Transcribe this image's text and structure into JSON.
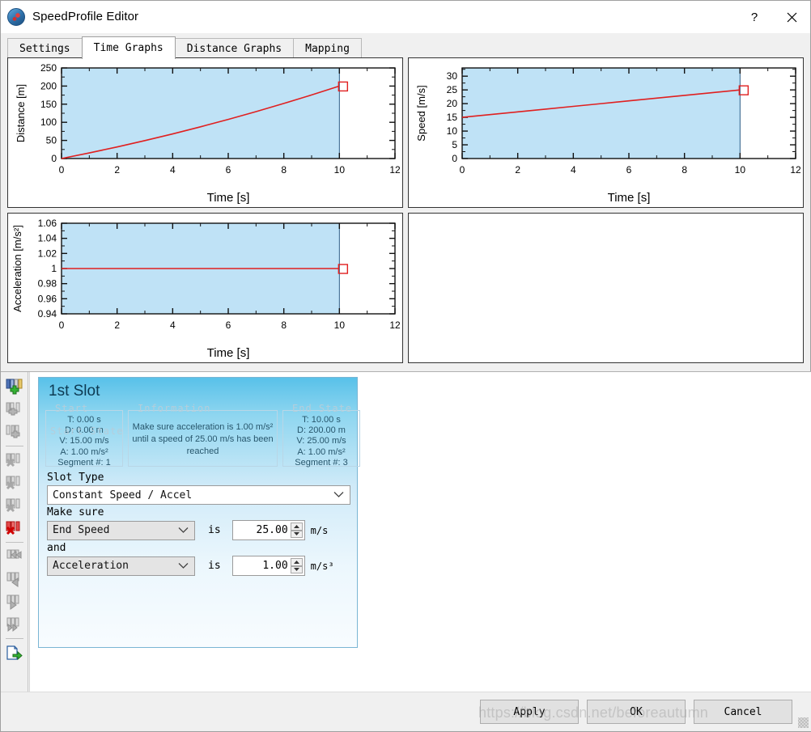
{
  "window": {
    "title": "SpeedProfile Editor",
    "icon": "app-globe-icon",
    "help_label": "?",
    "close_label": "✕"
  },
  "tabs": [
    {
      "label": "Settings",
      "active": false
    },
    {
      "label": "Time Graphs",
      "active": true
    },
    {
      "label": "Distance Graphs",
      "active": false
    },
    {
      "label": "Mapping",
      "active": false
    }
  ],
  "chart_data": [
    {
      "type": "line",
      "title": "",
      "xlabel": "Time [s]",
      "ylabel": "Distance [m]",
      "xlim": [
        0,
        12
      ],
      "ylim": [
        0,
        250
      ],
      "xticks": [
        0,
        2,
        4,
        6,
        8,
        10,
        12
      ],
      "yticks": [
        0,
        50,
        100,
        150,
        200,
        250
      ],
      "ytick_labels": [
        "0",
        "50",
        "100",
        "150",
        "200",
        "250"
      ],
      "grid": false,
      "legend": "none",
      "highlight_region": {
        "x0": 0,
        "x1": 10,
        "color": "#bfe2f6"
      },
      "marker": {
        "x": 10,
        "y": 200,
        "style": "open-square",
        "color": "#e02020"
      },
      "series": [
        {
          "name": "distance",
          "color": "#e02020",
          "x": [
            0,
            1,
            2,
            3,
            4,
            5,
            6,
            7,
            8,
            9,
            10
          ],
          "y": [
            0,
            15.5,
            32,
            49.5,
            68,
            87.5,
            108,
            129.5,
            152,
            175.5,
            200
          ]
        }
      ]
    },
    {
      "type": "line",
      "title": "",
      "xlabel": "Time [s]",
      "ylabel": "Speed [m/s]",
      "xlim": [
        0,
        12
      ],
      "ylim": [
        0,
        33
      ],
      "xticks": [
        0,
        2,
        4,
        6,
        8,
        10,
        12
      ],
      "yticks": [
        0,
        5,
        10,
        15,
        20,
        25,
        30
      ],
      "ytick_labels": [
        "0",
        "5",
        "10",
        "15",
        "20",
        "25",
        "30"
      ],
      "grid": false,
      "legend": "none",
      "highlight_region": {
        "x0": 0,
        "x1": 10,
        "color": "#bfe2f6"
      },
      "marker": {
        "x": 10,
        "y": 25,
        "style": "open-square",
        "color": "#e02020"
      },
      "series": [
        {
          "name": "speed",
          "color": "#e02020",
          "x": [
            0,
            1,
            2,
            3,
            4,
            5,
            6,
            7,
            8,
            9,
            10
          ],
          "y": [
            15,
            16,
            17,
            18,
            19,
            20,
            21,
            22,
            23,
            24,
            25
          ]
        }
      ]
    },
    {
      "type": "line",
      "title": "",
      "xlabel": "Time [s]",
      "ylabel": "Acceleration [m/s²]",
      "xlim": [
        0,
        12
      ],
      "ylim": [
        0.94,
        1.06
      ],
      "xticks": [
        0,
        2,
        4,
        6,
        8,
        10,
        12
      ],
      "yticks": [
        0.94,
        0.96,
        0.98,
        1,
        1.02,
        1.04,
        1.06
      ],
      "ytick_labels": [
        "0.94",
        "0.96",
        "0.98",
        "1",
        "1.02",
        "1.04",
        "1.06"
      ],
      "grid": false,
      "legend": "none",
      "highlight_region": {
        "x0": 0,
        "x1": 10,
        "color": "#bfe2f6"
      },
      "marker": {
        "x": 10,
        "y": 1,
        "style": "open-square",
        "color": "#e02020"
      },
      "series": [
        {
          "name": "acceleration",
          "color": "#e02020",
          "x": [
            0,
            10
          ],
          "y": [
            1,
            1
          ]
        }
      ]
    },
    {
      "type": "line",
      "title": "",
      "empty": true,
      "xlabel": "",
      "ylabel": "",
      "series": []
    }
  ],
  "toolbar": {
    "items": [
      {
        "name": "add-slot-icon",
        "state": "enabled"
      },
      {
        "name": "insert-slot-before-icon",
        "state": "disabled"
      },
      {
        "name": "insert-slot-after-icon",
        "state": "disabled"
      },
      {
        "name": "separator",
        "state": "none"
      },
      {
        "name": "delete-slot-before-icon",
        "state": "disabled"
      },
      {
        "name": "delete-slot-after-icon",
        "state": "disabled"
      },
      {
        "name": "delete-slot-icon",
        "state": "disabled"
      },
      {
        "name": "delete-active-slot-icon",
        "state": "active"
      },
      {
        "name": "separator",
        "state": "none"
      },
      {
        "name": "move-slot-first-icon",
        "state": "disabled"
      },
      {
        "name": "move-slot-left-icon",
        "state": "disabled"
      },
      {
        "name": "move-slot-right-icon",
        "state": "disabled"
      },
      {
        "name": "move-slot-last-icon",
        "state": "disabled"
      },
      {
        "name": "separator",
        "state": "none"
      },
      {
        "name": "export-profile-icon",
        "state": "enabled"
      }
    ]
  },
  "slot": {
    "title": "1st Slot",
    "start_group": {
      "label": "Start",
      "overlap_label": "Start State",
      "lines": [
        "T: 0.00 s",
        "D: 0.00 m",
        "V: 15.00 m/s",
        "A: 1.00 m/s²",
        "Segment #: 1"
      ]
    },
    "info_group": {
      "label": "Information",
      "text": "Make sure acceleration is 1.00 m/s² until a speed of 25.00 m/s has been reached"
    },
    "end_group": {
      "label": "End State",
      "lines": [
        "T: 10.00 s",
        "D: 200.00 m",
        "V: 25.00 m/s",
        "A: 1.00 m/s²",
        "Segment #: 3"
      ]
    },
    "form": {
      "slot_type_label": "Slot Type",
      "slot_type_value": "Constant Speed / Accel",
      "make_sure_label": "Make sure",
      "and_label": "and",
      "is_label_1": "is",
      "is_label_2": "is",
      "condition1_field": "End Speed",
      "condition1_value": "25.00",
      "condition1_unit": "m/s",
      "condition2_field": "Acceleration",
      "condition2_value": "1.00",
      "condition2_unit": "m/s³"
    }
  },
  "footer": {
    "apply_label": "Apply",
    "apply_mnemonic": "A",
    "ok_label": "OK",
    "ok_mnemonic": "O",
    "cancel_label": "Cancel",
    "cancel_mnemonic": "C",
    "watermark": "https://blog.csdn.net/beforeautumn"
  },
  "colors": {
    "chart_fill": "#bfe2f6",
    "chart_line": "#e02020",
    "slot_header": "#58c1e9",
    "active_tool": "#e01b1b"
  }
}
